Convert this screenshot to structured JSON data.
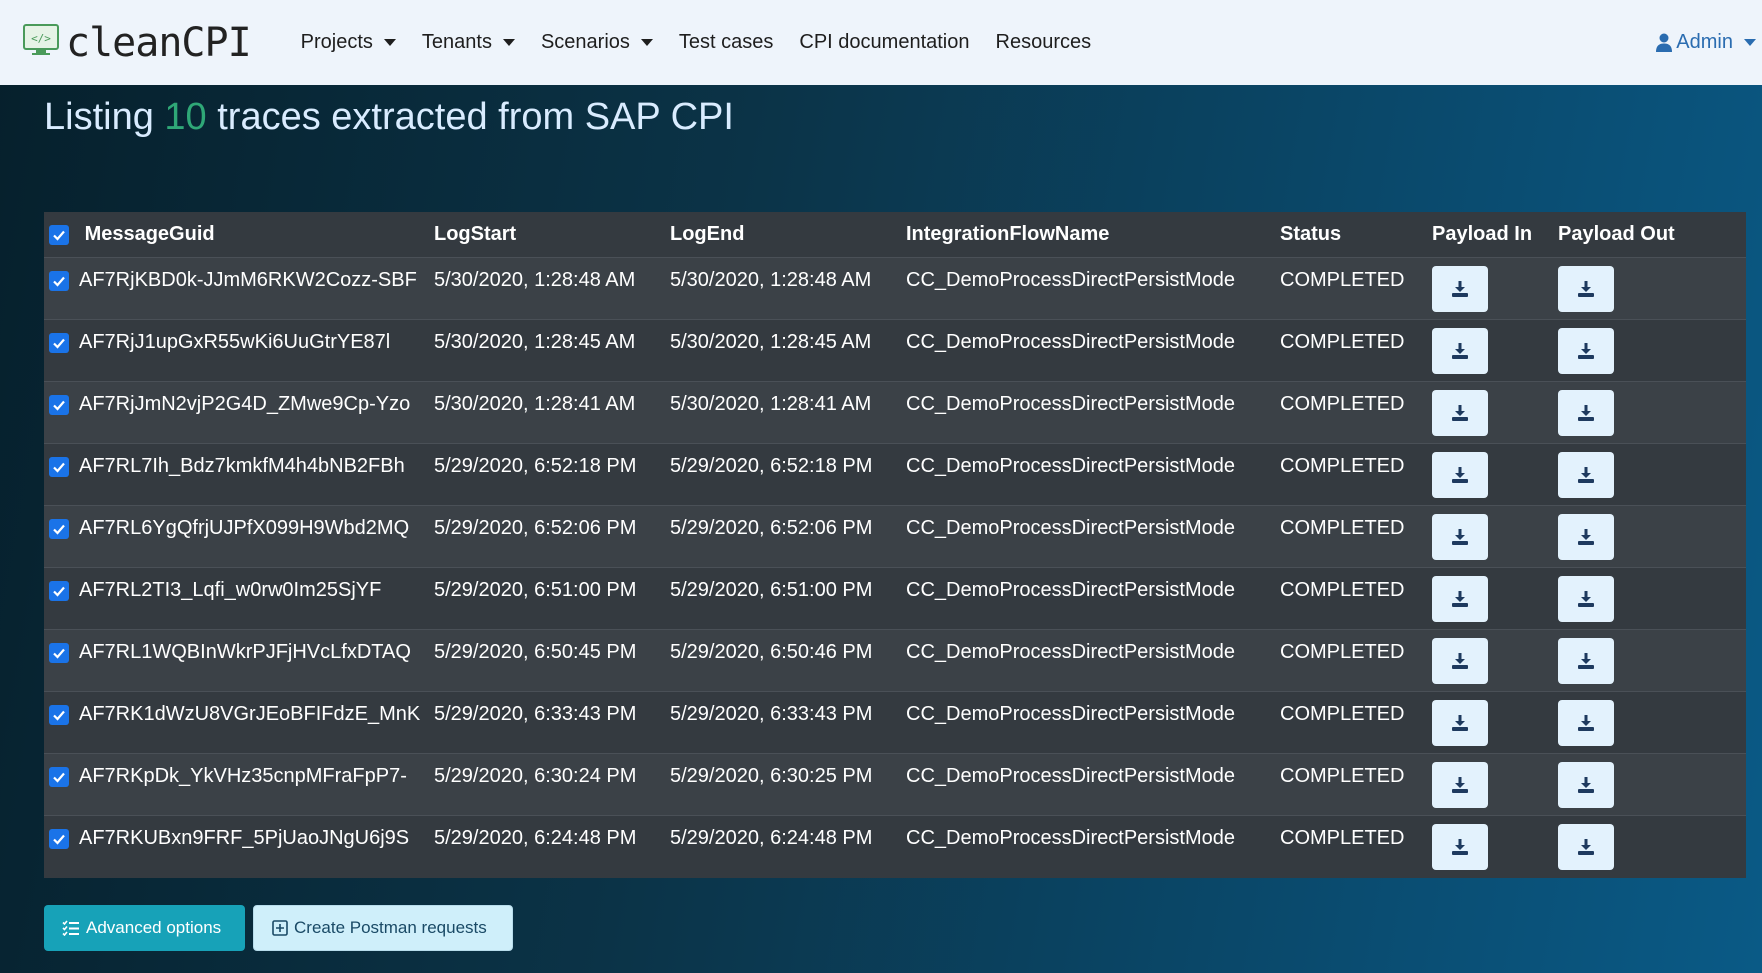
{
  "navbar": {
    "brand": "cleanCPI",
    "brand_icon": "code-monitor-icon",
    "items": [
      {
        "label": "Projects",
        "dropdown": true
      },
      {
        "label": "Tenants",
        "dropdown": true
      },
      {
        "label": "Scenarios",
        "dropdown": true
      },
      {
        "label": "Test cases",
        "dropdown": false
      },
      {
        "label": "CPI documentation",
        "dropdown": false
      },
      {
        "label": "Resources",
        "dropdown": false
      }
    ],
    "user": "Admin"
  },
  "title": {
    "prefix": "Listing",
    "count": "10",
    "suffix": "traces extracted from SAP CPI"
  },
  "table": {
    "headers": [
      "MessageGuid",
      "LogStart",
      "LogEnd",
      "IntegrationFlowName",
      "Status",
      "Payload In",
      "Payload Out"
    ],
    "header_checked": true,
    "rows": [
      {
        "checked": true,
        "guid": "AF7RjKBD0k-JJmM6RKW2Cozz-SBF",
        "start": "5/30/2020, 1:28:48 AM",
        "end": "5/30/2020, 1:28:48 AM",
        "flow": "CC_DemoProcessDirectPersistMode",
        "status": "COMPLETED"
      },
      {
        "checked": true,
        "guid": "AF7RjJ1upGxR55wKi6UuGtrYE87l",
        "start": "5/30/2020, 1:28:45 AM",
        "end": "5/30/2020, 1:28:45 AM",
        "flow": "CC_DemoProcessDirectPersistMode",
        "status": "COMPLETED"
      },
      {
        "checked": true,
        "guid": "AF7RjJmN2vjP2G4D_ZMwe9Cp-Yzo",
        "start": "5/30/2020, 1:28:41 AM",
        "end": "5/30/2020, 1:28:41 AM",
        "flow": "CC_DemoProcessDirectPersistMode",
        "status": "COMPLETED"
      },
      {
        "checked": true,
        "guid": "AF7RL7Ih_Bdz7kmkfM4h4bNB2FBh",
        "start": "5/29/2020, 6:52:18 PM",
        "end": "5/29/2020, 6:52:18 PM",
        "flow": "CC_DemoProcessDirectPersistMode",
        "status": "COMPLETED"
      },
      {
        "checked": true,
        "guid": "AF7RL6YgQfrjUJPfX099H9Wbd2MQ",
        "start": "5/29/2020, 6:52:06 PM",
        "end": "5/29/2020, 6:52:06 PM",
        "flow": "CC_DemoProcessDirectPersistMode",
        "status": "COMPLETED"
      },
      {
        "checked": true,
        "guid": "AF7RL2TI3_Lqfi_w0rw0Im25SjYF",
        "start": "5/29/2020, 6:51:00 PM",
        "end": "5/29/2020, 6:51:00 PM",
        "flow": "CC_DemoProcessDirectPersistMode",
        "status": "COMPLETED"
      },
      {
        "checked": true,
        "guid": "AF7RL1WQBInWkrPJFjHVcLfxDTAQ",
        "start": "5/29/2020, 6:50:45 PM",
        "end": "5/29/2020, 6:50:46 PM",
        "flow": "CC_DemoProcessDirectPersistMode",
        "status": "COMPLETED"
      },
      {
        "checked": true,
        "guid": "AF7RK1dWzU8VGrJEoBFIFdzE_MnK",
        "start": "5/29/2020, 6:33:43 PM",
        "end": "5/29/2020, 6:33:43 PM",
        "flow": "CC_DemoProcessDirectPersistMode",
        "status": "COMPLETED"
      },
      {
        "checked": true,
        "guid": "AF7RKpDk_YkVHz35cnpMFraFpP7-",
        "start": "5/29/2020, 6:30:24 PM",
        "end": "5/29/2020, 6:30:25 PM",
        "flow": "CC_DemoProcessDirectPersistMode",
        "status": "COMPLETED"
      },
      {
        "checked": true,
        "guid": "AF7RKUBxn9FRF_5PjUaoJNgU6j9S",
        "start": "5/29/2020, 6:24:48 PM",
        "end": "5/29/2020, 6:24:48 PM",
        "flow": "CC_DemoProcessDirectPersistMode",
        "status": "COMPLETED"
      }
    ],
    "download_icon": "download-icon"
  },
  "actions": {
    "advanced_options": "Advanced options",
    "advanced_icon": "list-check-icon",
    "create_postman": "Create Postman requests",
    "postman_icon": "plus-square-icon"
  },
  "colors": {
    "accent_count": "#2fa877",
    "navbar_bg": "#eef4fb",
    "table_bg": "#343a40",
    "checkbox": "#1a73e8",
    "advanced_btn": "#17a2b8"
  }
}
